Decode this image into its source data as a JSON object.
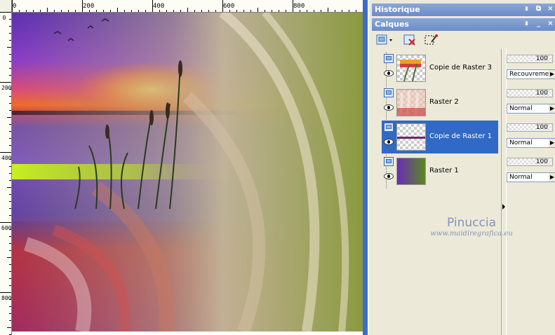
{
  "rulers": {
    "top_labels": [
      "0",
      "200",
      "400",
      "600",
      "800"
    ],
    "left_labels": [
      "0",
      "200",
      "400",
      "600",
      "800"
    ]
  },
  "palettes": {
    "history_title": "Historique",
    "layers_title": "Calques",
    "pin_glyph": "ᵻ",
    "float_glyph": "⧉",
    "minimize_glyph": "_",
    "close_glyph": "×"
  },
  "layers": [
    {
      "name": "Copie de Raster 3",
      "opacity": "100",
      "blend": "Recouvrement",
      "selected": false
    },
    {
      "name": "Raster 2",
      "opacity": "100",
      "blend": "Normal",
      "selected": false
    },
    {
      "name": "Copie de Raster 1",
      "opacity": "100",
      "blend": "Normal",
      "selected": true
    },
    {
      "name": "Raster 1",
      "opacity": "100",
      "blend": "Normal",
      "selected": false
    }
  ],
  "icons": {
    "visibility": "layer-visibility-icon",
    "eye": "eye-icon",
    "new_layer": "new-layer-icon",
    "delete_layer": "delete-layer-icon",
    "mask": "mask-icon"
  },
  "watermark": {
    "name": "Pinuccia",
    "url": "www.maidiregrafica.eu"
  },
  "colors": {
    "title_bar": "#7a98d0",
    "selection": "#316ac5",
    "canvas_edge": "#3d6cc8"
  }
}
